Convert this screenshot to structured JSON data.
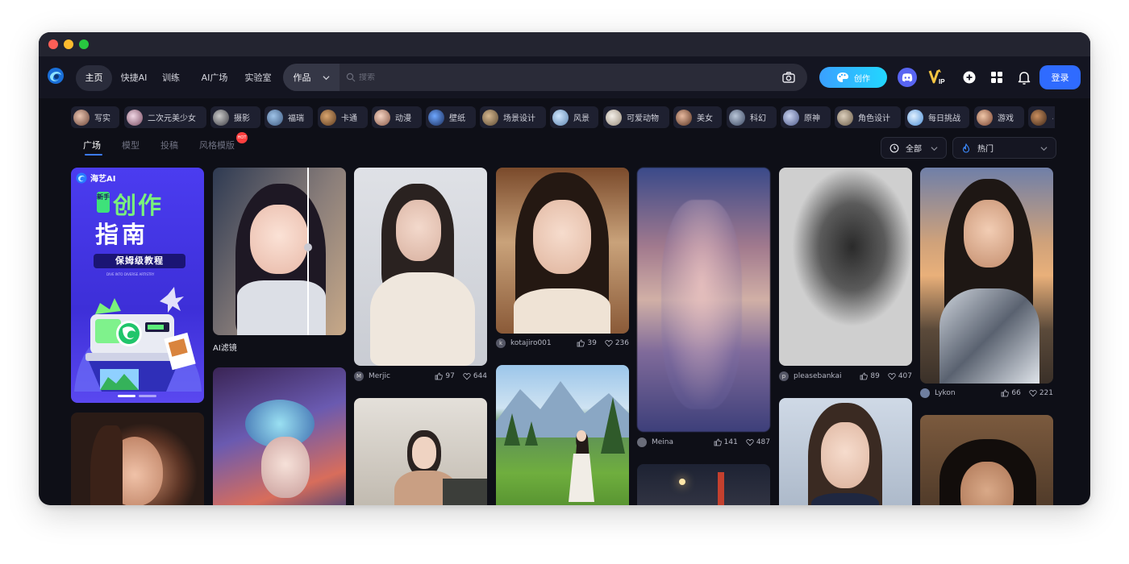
{
  "nav": {
    "tabs": [
      "主页",
      "快捷AI",
      "训练",
      "AI广场",
      "实验室"
    ],
    "active_tab": "主页",
    "search_type": "作品",
    "search_placeholder": "搜索",
    "create_label": "创作",
    "login_label": "登录",
    "vip_label": "VIP"
  },
  "tags": [
    "写实",
    "二次元美少女",
    "摄影",
    "福瑞",
    "卡通",
    "动漫",
    "壁纸",
    "场景设计",
    "风景",
    "可爱动物",
    "美女",
    "科幻",
    "原神",
    "角色设计",
    "每日挑战",
    "游戏",
    "..."
  ],
  "subtabs": [
    "广场",
    "模型",
    "投稿",
    "风格模版"
  ],
  "hot_badge": "HOT",
  "filters": {
    "time": "全部",
    "sort": "热门"
  },
  "banner": {
    "brand": "海艺AI",
    "badge": "新手",
    "title_line1": "创作",
    "title_line2": "指南",
    "subtitle": "保姆级教程",
    "tagline": "DIVE INTO DIVERSE ARTISTRY"
  },
  "cards": [
    {
      "caption": "AI滤镜"
    },
    {
      "user": "Merjic",
      "avatar": "M",
      "likes": "97",
      "favs": "644"
    },
    {
      "user": "kotajiro001",
      "avatar": "k",
      "likes": "39",
      "favs": "236"
    },
    {
      "user": "Meina",
      "likes": "141",
      "favs": "487"
    },
    {
      "user": "pleasebankai",
      "avatar": "p",
      "likes": "89",
      "favs": "407"
    },
    {
      "user": "Lykon",
      "likes": "66",
      "favs": "221"
    }
  ],
  "colors": {
    "window_bg": "#0e0f17",
    "accent_blue": "#2f6bff",
    "create_gradient": "#22d7ff"
  }
}
